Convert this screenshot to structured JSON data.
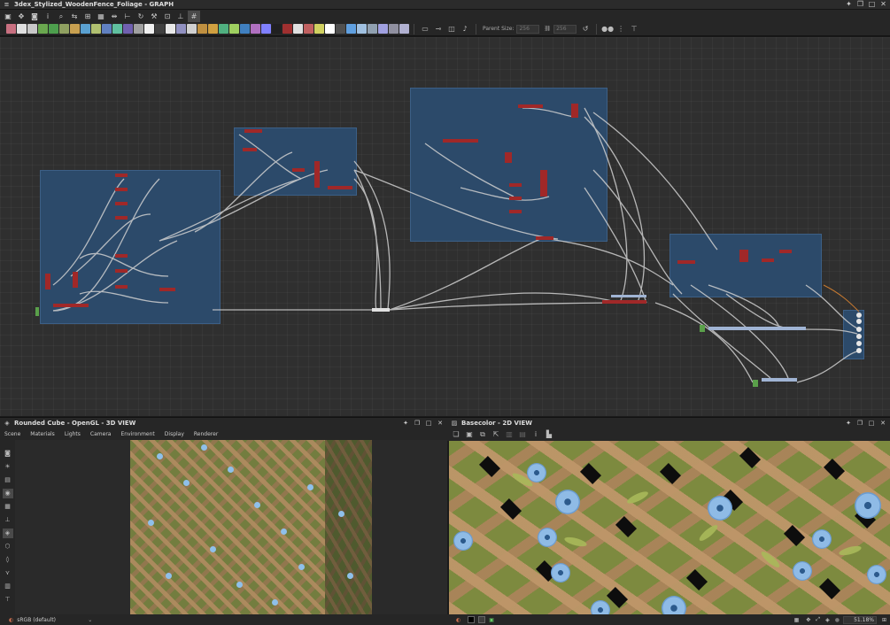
{
  "app": {
    "window_title": "3dex_Stylized_WoodenFence_Foliage - GRAPH"
  },
  "toolbar": {
    "parent_size_label": "Parent Size:",
    "parent_size_value": "256",
    "size_value": "256",
    "icons": [
      "frame-icon",
      "move-icon",
      "camera-icon",
      "info-icon",
      "search-icon",
      "connect-icon",
      "layout-icon",
      "grid-icon",
      "align-icon",
      "hierarchy-icon",
      "refresh-icon",
      "tools-icon",
      "snap-icon",
      "lock-icon",
      "grid-toggle-icon"
    ]
  },
  "atomic_nodes": {
    "colors": [
      "#c87080",
      "#e0e0e0",
      "#c8c8c8",
      "#6aa84f",
      "#4d9f4d",
      "#8fa060",
      "#c8a050",
      "#5aa0d0",
      "#b0c070",
      "#6080c0",
      "#60c0a0",
      "#7060b0",
      "#a0a0a0",
      "#f0f0f0",
      "#404040",
      "#e8e8e8",
      "#9090c0",
      "#d0d0d0",
      "#c09040",
      "#d0a040",
      "#50b080",
      "#9fd060",
      "#4080c0",
      "#b070c0",
      "#8080ff",
      "#202020",
      "#a03030",
      "#e0e0e0",
      "#c06060",
      "#d0d060",
      "#ffffff",
      "#505050",
      "#60a0e0",
      "#a0c0e0",
      "#90a0b0",
      "#a0a0e0",
      "#9090a0",
      "#b0b0d0"
    ]
  },
  "panel_3d": {
    "title": "Rounded Cube - OpenGL - 3D VIEW",
    "menu": [
      "Scene",
      "Materials",
      "Lights",
      "Camera",
      "Environment",
      "Display",
      "Renderer"
    ],
    "colorspace": "sRGB (default)"
  },
  "panel_2d": {
    "title": "Basecolor - 2D VIEW",
    "zoom": "51.18%"
  }
}
